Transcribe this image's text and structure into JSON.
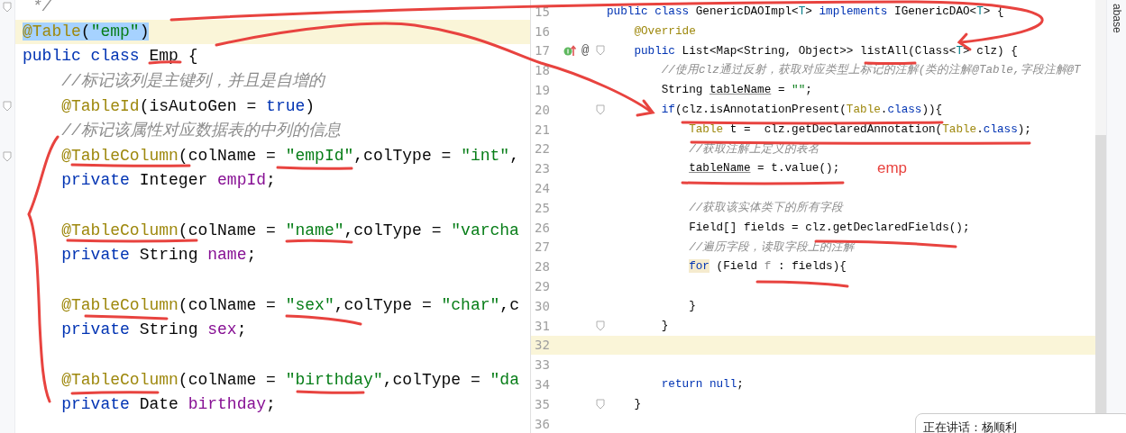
{
  "left_editor": {
    "lines": [
      {
        "current": false,
        "selected": false,
        "fold": true,
        "tokens": [
          {
            "kind": "comment",
            "text": " */"
          }
        ]
      },
      {
        "current": true,
        "selected": true,
        "fold": false,
        "tokens": [
          {
            "kind": "annotation",
            "text": "@Table"
          },
          {
            "kind": "plain",
            "text": "("
          },
          {
            "kind": "string",
            "text": "\"emp\""
          },
          {
            "kind": "plain",
            "text": ")"
          }
        ]
      },
      {
        "current": false,
        "selected": false,
        "fold": false,
        "tokens": [
          {
            "kind": "keyword",
            "text": "public class "
          },
          {
            "kind": "plain",
            "text": "Emp {"
          }
        ]
      },
      {
        "current": false,
        "selected": false,
        "fold": false,
        "tokens": [
          {
            "kind": "comment",
            "text": "    //标记该列是主键列，并且是自增的"
          }
        ]
      },
      {
        "current": false,
        "selected": false,
        "fold": true,
        "tokens": [
          {
            "kind": "annotation",
            "text": "    @TableId"
          },
          {
            "kind": "plain",
            "text": "(isAutoGen = "
          },
          {
            "kind": "keyword",
            "text": "true"
          },
          {
            "kind": "plain",
            "text": ")"
          }
        ]
      },
      {
        "current": false,
        "selected": false,
        "fold": false,
        "tokens": [
          {
            "kind": "comment",
            "text": "    //标记该属性对应数据表的中列的信息"
          }
        ]
      },
      {
        "current": false,
        "selected": false,
        "fold": true,
        "tokens": [
          {
            "kind": "annotation",
            "text": "    @TableColumn"
          },
          {
            "kind": "plain",
            "text": "(colName = "
          },
          {
            "kind": "string",
            "text": "\"empId\""
          },
          {
            "kind": "plain",
            "text": ",colType = "
          },
          {
            "kind": "string",
            "text": "\"int\""
          },
          {
            "kind": "plain",
            "text": ","
          }
        ]
      },
      {
        "current": false,
        "selected": false,
        "fold": false,
        "tokens": [
          {
            "kind": "keyword",
            "text": "    private "
          },
          {
            "kind": "plain",
            "text": "Integer "
          },
          {
            "kind": "field",
            "text": "empId"
          },
          {
            "kind": "plain",
            "text": ";"
          }
        ]
      },
      {
        "current": false,
        "selected": false,
        "fold": false
      },
      {
        "current": false,
        "selected": false,
        "fold": false,
        "tokens": [
          {
            "kind": "annotation",
            "text": "    @TableColumn"
          },
          {
            "kind": "plain",
            "text": "(colName = "
          },
          {
            "kind": "string",
            "text": "\"name\""
          },
          {
            "kind": "plain",
            "text": ",colType = "
          },
          {
            "kind": "string",
            "text": "\"varcha"
          }
        ]
      },
      {
        "current": false,
        "selected": false,
        "fold": false,
        "tokens": [
          {
            "kind": "keyword",
            "text": "    private "
          },
          {
            "kind": "plain",
            "text": "String "
          },
          {
            "kind": "field",
            "text": "name"
          },
          {
            "kind": "plain",
            "text": ";"
          }
        ]
      },
      {
        "current": false,
        "selected": false,
        "fold": false
      },
      {
        "current": false,
        "selected": false,
        "fold": false,
        "tokens": [
          {
            "kind": "annotation",
            "text": "    @TableColumn"
          },
          {
            "kind": "plain",
            "text": "(colName = "
          },
          {
            "kind": "string",
            "text": "\"sex\""
          },
          {
            "kind": "plain",
            "text": ",colType = "
          },
          {
            "kind": "string",
            "text": "\"char\""
          },
          {
            "kind": "plain",
            "text": ",c"
          }
        ]
      },
      {
        "current": false,
        "selected": false,
        "fold": false,
        "tokens": [
          {
            "kind": "keyword",
            "text": "    private "
          },
          {
            "kind": "plain",
            "text": "String "
          },
          {
            "kind": "field",
            "text": "sex"
          },
          {
            "kind": "plain",
            "text": ";"
          }
        ]
      },
      {
        "current": false,
        "selected": false,
        "fold": false
      },
      {
        "current": false,
        "selected": false,
        "fold": false,
        "tokens": [
          {
            "kind": "annotation",
            "text": "    @TableColumn"
          },
          {
            "kind": "plain",
            "text": "(colName = "
          },
          {
            "kind": "string",
            "text": "\"birthday\""
          },
          {
            "kind": "plain",
            "text": ",colType = "
          },
          {
            "kind": "string",
            "text": "\"da"
          }
        ]
      },
      {
        "current": false,
        "selected": false,
        "fold": false,
        "tokens": [
          {
            "kind": "keyword",
            "text": "    private "
          },
          {
            "kind": "plain",
            "text": "Date "
          },
          {
            "kind": "field",
            "text": "birthday"
          },
          {
            "kind": "plain",
            "text": ";"
          }
        ]
      }
    ]
  },
  "right_editor": {
    "lines": [
      {
        "number": "15",
        "current": false,
        "fold": false,
        "tokens": [
          {
            "kind": "keyword",
            "text": "public class "
          },
          {
            "kind": "plain",
            "text": "GenericDAOImpl<"
          },
          {
            "kind": "type_param",
            "text": "T"
          },
          {
            "kind": "plain",
            "text": "> "
          },
          {
            "kind": "keyword",
            "text": "implements "
          },
          {
            "kind": "plain",
            "text": "IGenericDAO<"
          },
          {
            "kind": "type_param",
            "text": "T"
          },
          {
            "kind": "plain",
            "text": "> {"
          }
        ]
      },
      {
        "number": "16",
        "current": false,
        "fold": false,
        "tokens": [
          {
            "kind": "annotation",
            "text": "    @Override"
          }
        ]
      },
      {
        "number": "17",
        "current": false,
        "fold": true,
        "gutter_icon": true,
        "gutter_glyph": "@",
        "tokens": [
          {
            "kind": "keyword",
            "text": "    public "
          },
          {
            "kind": "plain",
            "text": "List<Map<String, Object>> "
          },
          {
            "kind": "method_underlined",
            "text": "listAll"
          },
          {
            "kind": "plain",
            "text": "(Class<"
          },
          {
            "kind": "type_param",
            "text": "T"
          },
          {
            "kind": "plain",
            "text": "> clz) {"
          }
        ]
      },
      {
        "number": "18",
        "current": false,
        "fold": false,
        "tokens": [
          {
            "kind": "comment",
            "text": "        //使用clz通过反射，获取对应类型上标记的注解(类的注解@Table,字段注解@T"
          }
        ]
      },
      {
        "number": "19",
        "current": false,
        "fold": false,
        "tokens": [
          {
            "kind": "plain",
            "text": "        String "
          },
          {
            "kind": "reassigned",
            "text": "tableName"
          },
          {
            "kind": "plain",
            "text": " = "
          },
          {
            "kind": "string",
            "text": "\"\""
          },
          {
            "kind": "plain",
            "text": ";"
          }
        ]
      },
      {
        "number": "20",
        "current": false,
        "fold": true,
        "tokens": [
          {
            "kind": "keyword",
            "text": "        if"
          },
          {
            "kind": "plain",
            "text": "(clz.isAnnotationPresent("
          },
          {
            "kind": "annotation",
            "text": "Table"
          },
          {
            "kind": "plain",
            "text": "."
          },
          {
            "kind": "keyword",
            "text": "class"
          },
          {
            "kind": "plain",
            "text": ")){"
          }
        ]
      },
      {
        "number": "21",
        "current": false,
        "fold": false,
        "tokens": [
          {
            "kind": "annotation",
            "text": "            Table"
          },
          {
            "kind": "plain",
            "text": " t =  clz.getDeclaredAnnotation("
          },
          {
            "kind": "annotation",
            "text": "Table"
          },
          {
            "kind": "plain",
            "text": "."
          },
          {
            "kind": "keyword",
            "text": "class"
          },
          {
            "kind": "plain",
            "text": ");"
          }
        ]
      },
      {
        "number": "22",
        "current": false,
        "fold": false,
        "tokens": [
          {
            "kind": "comment",
            "text": "            //获取注解上定义的表名"
          }
        ]
      },
      {
        "number": "23",
        "current": false,
        "fold": false,
        "note": "emp",
        "tokens": [
          {
            "kind": "reassigned",
            "text": "            tableName"
          },
          {
            "kind": "plain",
            "text": " = t.value();"
          }
        ]
      },
      {
        "number": "24",
        "current": false,
        "fold": false
      },
      {
        "number": "25",
        "current": false,
        "fold": false,
        "tokens": [
          {
            "kind": "comment",
            "text": "            //获取该实体类下的所有字段"
          }
        ]
      },
      {
        "number": "26",
        "current": false,
        "fold": false,
        "tokens": [
          {
            "kind": "plain",
            "text": "            Field[] fields = clz.getDeclaredFields();"
          }
        ]
      },
      {
        "number": "27",
        "current": false,
        "fold": false,
        "tokens": [
          {
            "kind": "comment",
            "text": "            //遍历字段，读取字段上的注解"
          }
        ]
      },
      {
        "number": "28",
        "current": false,
        "fold": false,
        "tokens": [
          {
            "kind": "keyword_marked",
            "text": "            for"
          },
          {
            "kind": "plain",
            "text": " (Field "
          },
          {
            "kind": "unused",
            "text": "f"
          },
          {
            "kind": "plain",
            "text": " : fields){"
          }
        ]
      },
      {
        "number": "29",
        "current": false,
        "fold": false
      },
      {
        "number": "30",
        "current": false,
        "fold": false,
        "tokens": [
          {
            "kind": "plain",
            "text": "            }"
          }
        ]
      },
      {
        "number": "31",
        "current": false,
        "fold": true,
        "tokens": [
          {
            "kind": "plain",
            "text": "        }"
          }
        ]
      },
      {
        "number": "32",
        "current": true,
        "fold": false
      },
      {
        "number": "33",
        "current": false,
        "fold": false
      },
      {
        "number": "34",
        "current": false,
        "fold": false,
        "tokens": [
          {
            "kind": "keyword",
            "text": "        return null"
          },
          {
            "kind": "plain",
            "text": ";"
          }
        ]
      },
      {
        "number": "35",
        "current": false,
        "fold": true,
        "tokens": [
          {
            "kind": "plain",
            "text": "    }"
          }
        ]
      },
      {
        "number": "36",
        "current": false,
        "fold": false
      }
    ]
  },
  "tool_window_tab": "abase",
  "speaker_notification": "正在讲话：杨顺利"
}
